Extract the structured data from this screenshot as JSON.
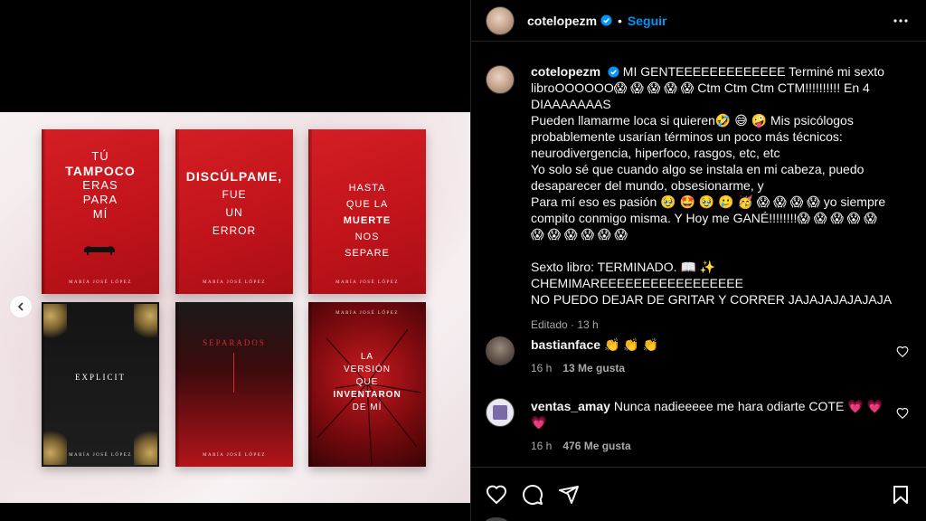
{
  "post": {
    "username": "cotelopezm",
    "follow_label": "Seguir",
    "separator": "•"
  },
  "books": [
    {
      "title_lines": [
        "TÚ",
        "TAMPOCO",
        "ERAS",
        "PARA",
        "MÍ"
      ],
      "author": "MARÍA JOSÉ LÓPEZ"
    },
    {
      "title_lines": [
        "DISCÚLPAME,",
        "FUE",
        "UN",
        "ERROR"
      ],
      "author": "MARÍA JOSÉ LÓPEZ"
    },
    {
      "title_lines": [
        "HASTA",
        "QUE LA",
        "MUERTE",
        "NOS",
        "SEPARE"
      ],
      "author": "MARÍA JOSÉ LÓPEZ"
    },
    {
      "title_lines": [
        "EXPLICIT"
      ],
      "author": "MARÍA JOSÉ LÓPEZ"
    },
    {
      "title_lines": [
        "SEPARADOS"
      ],
      "author": "MARÍA JOSÉ LÓPEZ"
    },
    {
      "title_lines": [
        "LA",
        "VERSIÓN",
        "QUE",
        "INVENTARON",
        "DE MÍ"
      ],
      "author": "MARÍA JOSÉ LÓPEZ"
    }
  ],
  "caption": {
    "username": "cotelopezm",
    "lines": [
      "MI GENTEEEEEEEEEEEEE Terminé mi sexto",
      "libroOOOOOO😱 😱 😱 😱 😱  Ctm Ctm Ctm CTM!!!!!!!!!! En 4",
      "DIAAAAAAAS",
      "Pueden llamarme loca si quieren🤣 😅 🤪 Mis psicólogos",
      "probablemente usarían términos un poco más técnicos:",
      "neurodivergencia, hiperfoco, rasgos, etc, etc",
      "Yo solo sé que cuando algo se instala en mi cabeza, puedo",
      "desaparecer del mundo, obsesionarme, y",
      "Para mí eso es pasión 🥹 🤩 🥹 🥲 🥳 😱 😱 😱 😱  yo siempre",
      "compito conmigo misma. Y Hoy me GANÉ!!!!!!!!😱 😱 😱 😱 😱",
      "😱 😱 😱 😱 😱 😱",
      "",
      "Sexto libro: TERMINADO. 📖 ✨  CHEMIMAREEEEEEEEEEEEEEEEE",
      "NO PUEDO DEJAR DE GRITAR Y CORRER JAJAJAJAJAJAJA"
    ],
    "edited": "Editado",
    "time": "13 h"
  },
  "comments": [
    {
      "username": "bastianface",
      "text": "👏 👏 👏",
      "time": "16 h",
      "likes": "13 Me gusta"
    },
    {
      "username": "ventas_amay",
      "text": "Nunca nadieeeee me hara odiarte COTE 💗 💗 💗",
      "time": "16 h",
      "likes": "476 Me gusta"
    }
  ],
  "colors": {
    "accent": "#0095f6",
    "book_red": "#c0131a",
    "muted_text": "#a8a8a8"
  },
  "icons": [
    "verified-icon",
    "more-icon",
    "heart-icon",
    "comment-icon",
    "share-icon",
    "bookmark-icon",
    "chevron-left-icon"
  ]
}
